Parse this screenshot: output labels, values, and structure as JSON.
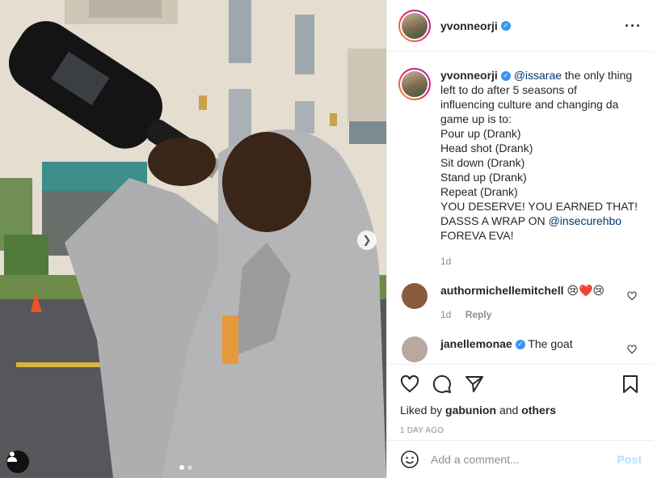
{
  "post": {
    "username": "yvonneorji",
    "verified": true,
    "caption": {
      "mention": "@issarae",
      "lines": [
        "the only thing",
        "left to do after 5 seasons of",
        "influencing culture and changing da",
        "game up is to:",
        "Pour up (Drank)",
        "Head shot (Drank)",
        "Sit down (Drank)",
        "Stand up (Drank)",
        "Repeat (Drank)",
        "YOU DESERVE! YOU EARNED THAT!",
        "DASSS A WRAP ON"
      ],
      "mention2": "@insecurehbo",
      "last_line": "FOREVA EVA!",
      "age": "1d"
    },
    "more_icon": "more-horizontal-icon"
  },
  "comments": [
    {
      "username": "authormichellemitchell",
      "text": "😢❤️😢",
      "age": "1d",
      "reply": "Reply",
      "avatar_color": "#8a5a3c"
    },
    {
      "username": "janellemonae",
      "verified": true,
      "text": "The goat",
      "avatar_color": "#b9a8a0"
    }
  ],
  "actions": {
    "liked_prefix": "Liked by",
    "liked_user": "gabunion",
    "liked_and": "and",
    "liked_others": "others",
    "date": "1 DAY AGO"
  },
  "add_comment": {
    "placeholder": "Add a comment...",
    "post_label": "Post"
  },
  "colors": {
    "accent": "#3897f0",
    "link": "#00376b",
    "muted": "#8e8e8e",
    "post_disabled": "#b2dffc",
    "heart_red": "#ed4956"
  }
}
